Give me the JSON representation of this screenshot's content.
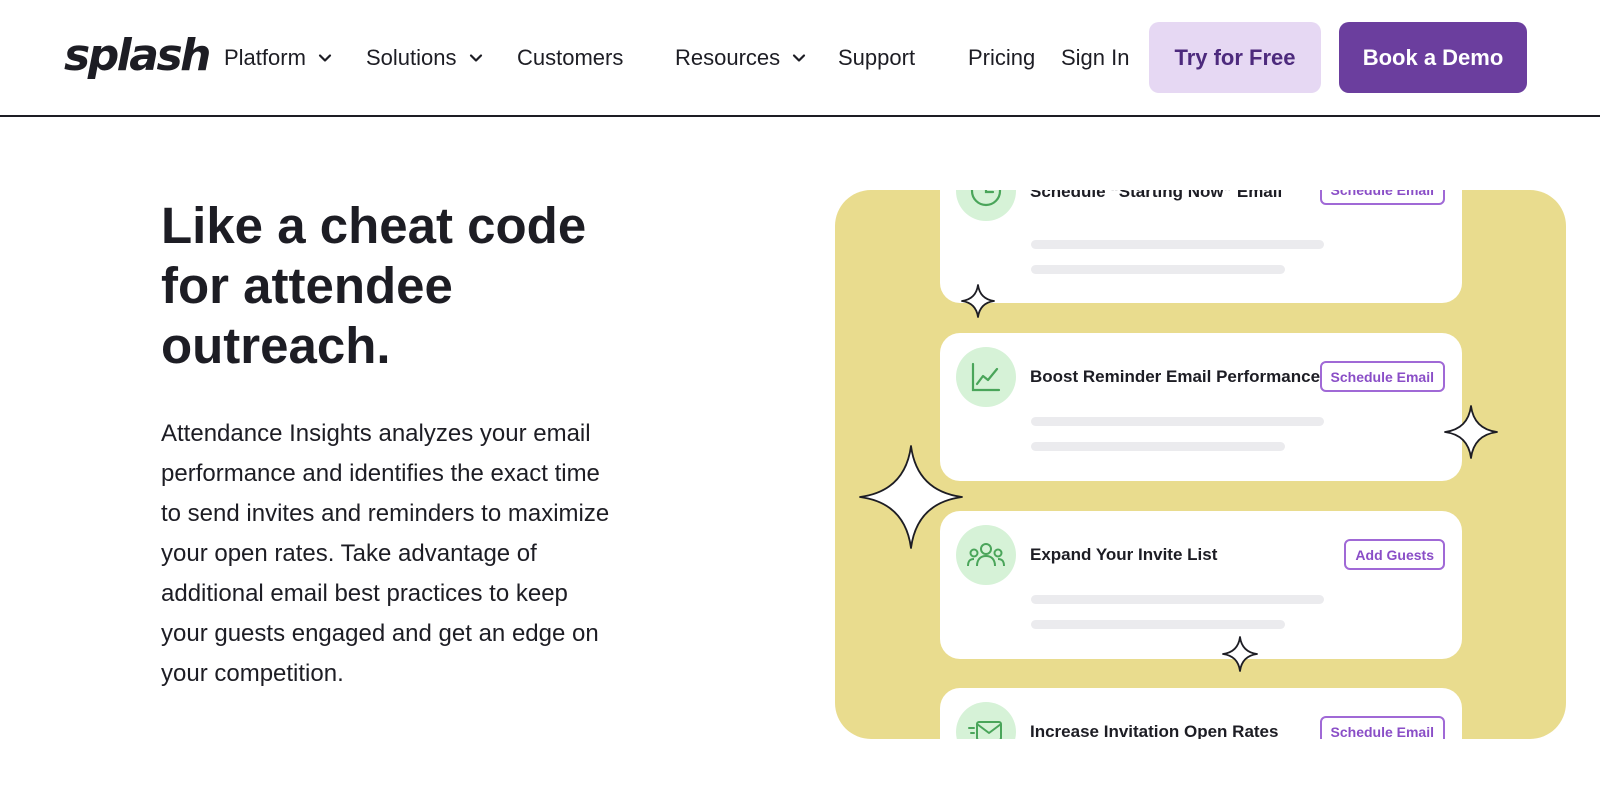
{
  "logo": {
    "text": "splash"
  },
  "nav": {
    "platform": "Platform",
    "solutions": "Solutions",
    "customers": "Customers",
    "resources": "Resources",
    "support": "Support",
    "pricing": "Pricing",
    "sign_in": "Sign In"
  },
  "buttons": {
    "try_free": "Try for Free",
    "book_demo": "Book a Demo"
  },
  "hero": {
    "headline": "Like a cheat code for attendee outreach.",
    "body": "Attendance Insights analyzes your email performance and identifies the exact time to send invites and reminders to maximize your open rates. Take advantage of additional email best practices to keep your guests engaged and get an edge on your competition."
  },
  "cards": [
    {
      "icon": "clock-icon",
      "title": "Schedule “Starting Now” Email",
      "action": "Schedule Email"
    },
    {
      "icon": "line-chart-icon",
      "title": "Boost Reminder Email Performance",
      "action": "Schedule Email"
    },
    {
      "icon": "people-group-icon",
      "title": "Expand Your Invite List",
      "action": "Add Guests"
    },
    {
      "icon": "envelope-send-icon",
      "title": "Increase Invitation Open Rates",
      "action": "Schedule Email"
    }
  ],
  "colors": {
    "text": "#1d1d24",
    "try_free_bg": "#e6d8f3",
    "book_demo_bg": "#6b3e9e",
    "panel_bg": "#e9dc8e",
    "icon_circle_bg": "#d6f2d7",
    "icon_stroke": "#4aa55a",
    "action_border": "#a069d6"
  }
}
